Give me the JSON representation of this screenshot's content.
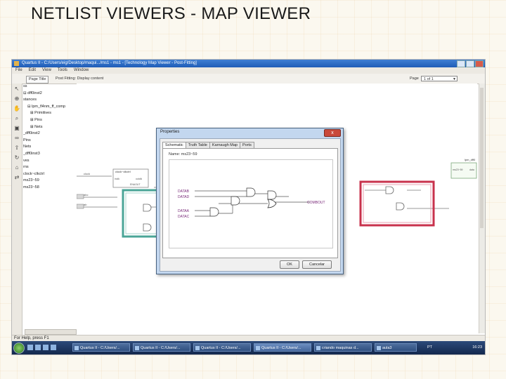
{
  "slide": {
    "title": "NETLIST VIEWERS - MAP VIEWER"
  },
  "window": {
    "title": "Quartus II - C:/Users/eig/Desktop/maqui.../ms1 - ms1 - [Technology Map Viewer - Post-Fitting]"
  },
  "menu": [
    "File",
    "Edit",
    "View",
    "Tools",
    "Window"
  ],
  "toolbar": {
    "page_title_button": "Page Title",
    "post_fitting_label": "Post Fitting: Display content",
    "page_label": "Page",
    "page_value": "1 of 1"
  },
  "left_tools": [
    "select",
    "zoom",
    "hand",
    "find",
    "fit",
    "binoculars",
    "up",
    "rotate",
    "home",
    "net"
  ],
  "tree": [
    "ss",
    "dff0inst2",
    "stances",
    "lpm_fl4nm_ff_comp",
    "Primitives",
    "Pins",
    "Nets",
    "_dff0inst2",
    "Pins",
    "Nets",
    "_dff0inst3",
    "ves",
    "rns",
    "clock~clkctrl",
    "ms23~59",
    "ms23~58"
  ],
  "canvas": {
    "block_left_title": "clock~clkctrl",
    "block_left_a": "inclk",
    "block_left_b": "outclk",
    "block_left_c": "ENAOUT",
    "block_right_title": "lpm_dff0",
    "block_right_a": "ms23~59",
    "block_right_b": "data",
    "pin_clock": "clock",
    "pin_a": "abc",
    "pin_b": "ab"
  },
  "dialog": {
    "title": "Properties",
    "close": "x",
    "tabs": [
      "Schematic",
      "Truth Table",
      "Karnaugh Map",
      "Ports"
    ],
    "name_label": "Name:",
    "name_value": "ms23~59",
    "inputs": [
      "DATAB",
      "DATAD",
      "DATAA",
      "DATAC"
    ],
    "output": "COMBOUT",
    "ok": "OK",
    "cancel": "Cancelar"
  },
  "status": {
    "text": "For Help, press F1"
  },
  "taskbar": {
    "buttons": [
      "Quartus II - C:/Users/...",
      "Quartus II - C:/Users/...",
      "Quartus II - C:/Users/...",
      "Quartus II - C:/Users/...",
      "criando maquinas d...",
      "aula3"
    ],
    "lang": "PT",
    "clock": "16:23"
  },
  "colors": {
    "teal_box": "#4aa597",
    "red_box": "#c8324c",
    "window_blue": "#1f5cb7"
  }
}
